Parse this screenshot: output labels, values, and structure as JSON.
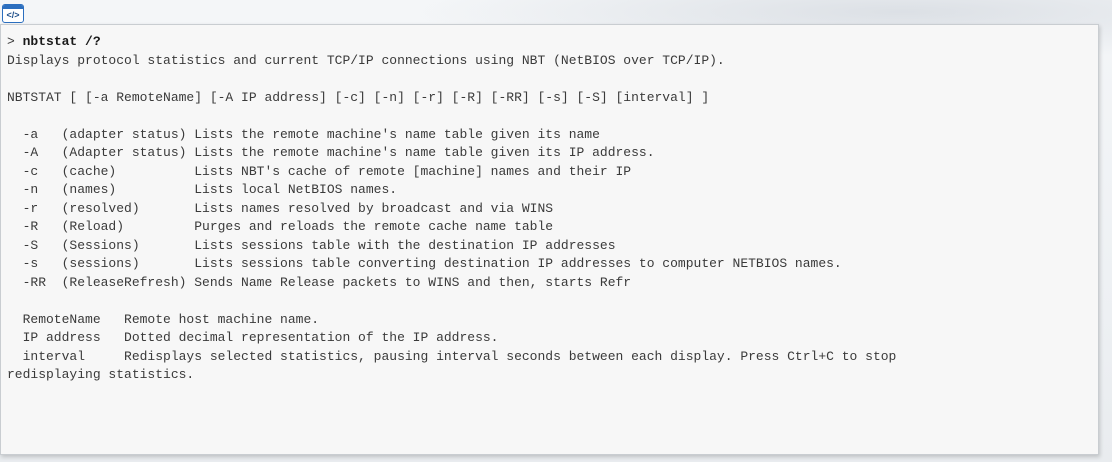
{
  "badge": {
    "icon": "code-icon",
    "glyph": "</>"
  },
  "console": {
    "prompt_symbol": "> ",
    "command": "nbtstat /?",
    "lines": [
      "Displays protocol statistics and current TCP/IP connections using NBT (NetBIOS over TCP/IP).",
      "",
      "NBTSTAT [ [-a RemoteName] [-A IP address] [-c] [-n] [-r] [-R] [-RR] [-s] [-S] [interval] ]",
      "",
      "  -a   (adapter status) Lists the remote machine's name table given its name",
      "  -A   (Adapter status) Lists the remote machine's name table given its IP address.",
      "  -c   (cache)          Lists NBT's cache of remote [machine] names and their IP",
      "  -n   (names)          Lists local NetBIOS names.",
      "  -r   (resolved)       Lists names resolved by broadcast and via WINS",
      "  -R   (Reload)         Purges and reloads the remote cache name table",
      "  -S   (Sessions)       Lists sessions table with the destination IP addresses",
      "  -s   (sessions)       Lists sessions table converting destination IP addresses to computer NETBIOS names.",
      "  -RR  (ReleaseRefresh) Sends Name Release packets to WINS and then, starts Refr",
      "",
      "  RemoteName   Remote host machine name.",
      "  IP address   Dotted decimal representation of the IP address.",
      "  interval     Redisplays selected statistics, pausing interval seconds between each display. Press Ctrl+C to stop",
      "redisplaying statistics."
    ]
  }
}
